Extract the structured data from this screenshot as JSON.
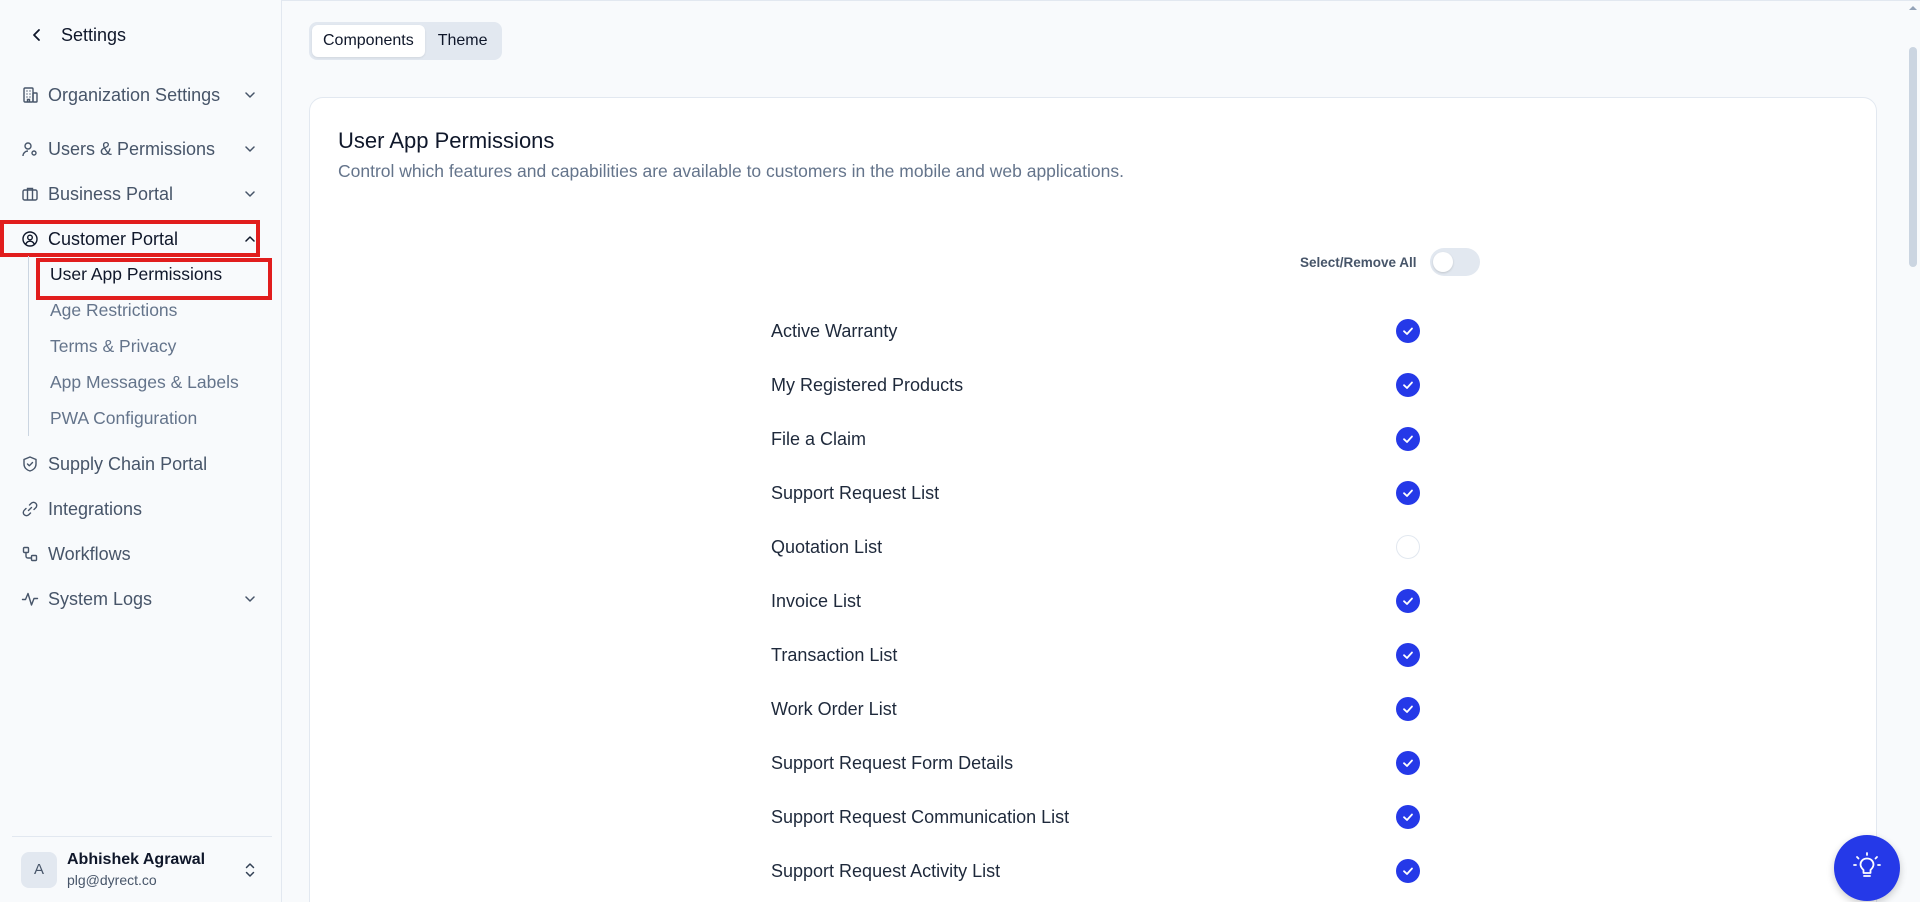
{
  "sidebar": {
    "header_title": "Settings",
    "nav": [
      {
        "label": "Organization Settings",
        "icon": "building-icon",
        "has_chevron": true
      },
      {
        "label": "Users & Permissions",
        "icon": "user-settings-icon",
        "has_chevron": true
      },
      {
        "label": "Business Portal",
        "icon": "briefcase-icon",
        "has_chevron": true
      },
      {
        "label": "Customer Portal",
        "icon": "user-circle-icon",
        "has_chevron": true,
        "expanded": true
      },
      {
        "label": "Supply Chain Portal",
        "icon": "shield-icon",
        "has_chevron": false
      },
      {
        "label": "Integrations",
        "icon": "link-icon",
        "has_chevron": false
      },
      {
        "label": "Workflows",
        "icon": "workflow-icon",
        "has_chevron": false
      },
      {
        "label": "System Logs",
        "icon": "activity-icon",
        "has_chevron": true
      }
    ],
    "customer_portal_sub": [
      {
        "label": "User App Permissions",
        "active": true
      },
      {
        "label": "Age Restrictions"
      },
      {
        "label": "Terms & Privacy"
      },
      {
        "label": "App Messages & Labels"
      },
      {
        "label": "PWA Configuration"
      }
    ],
    "user": {
      "initial": "A",
      "name": "Abhishek Agrawal",
      "email": "plg@dyrect.co"
    }
  },
  "main": {
    "tabs": [
      {
        "label": "Components",
        "active": true
      },
      {
        "label": "Theme",
        "active": false
      }
    ],
    "card": {
      "title": "User App Permissions",
      "description": "Control which features and capabilities are available to customers in the mobile and web applications.",
      "select_all_label": "Select/Remove All",
      "select_all_on": false,
      "permissions": [
        {
          "label": "Active Warranty",
          "checked": true
        },
        {
          "label": "My Registered Products",
          "checked": true
        },
        {
          "label": "File a Claim",
          "checked": true
        },
        {
          "label": "Support Request List",
          "checked": true
        },
        {
          "label": "Quotation List",
          "checked": false
        },
        {
          "label": "Invoice List",
          "checked": true
        },
        {
          "label": "Transaction List",
          "checked": true
        },
        {
          "label": "Work Order List",
          "checked": true
        },
        {
          "label": "Support Request Form Details",
          "checked": true
        },
        {
          "label": "Support Request Communication List",
          "checked": true
        },
        {
          "label": "Support Request Activity List",
          "checked": true
        }
      ]
    }
  },
  "colors": {
    "accent": "#2539e8",
    "highlight": "#e11d1d"
  }
}
